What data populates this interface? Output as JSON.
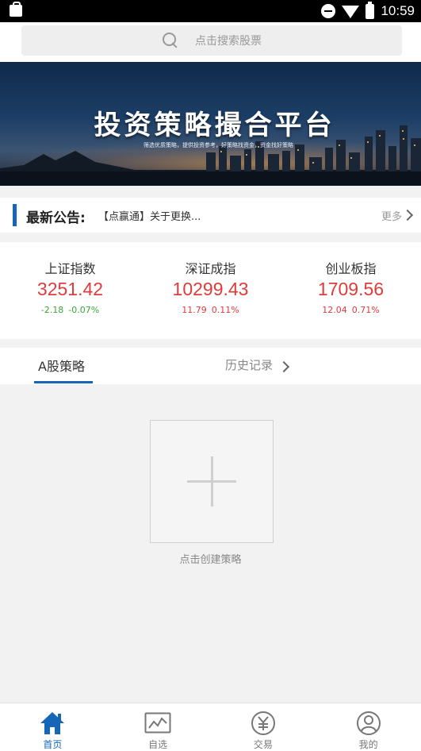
{
  "status_bar": {
    "time": "10:59"
  },
  "search": {
    "placeholder": "点击搜索股票"
  },
  "banner": {
    "title": "投资策略撮合平台",
    "subtitle": "筛选优质策略，提供投资参考，好策略找资金，资金找好策略"
  },
  "notice": {
    "title": "最新公告:",
    "text": "【点赢通】关于更换...",
    "more": "更多"
  },
  "indices": [
    {
      "name": "上证指数",
      "value": "3251.42",
      "change": "-2.18",
      "pct": "-0.07%",
      "trend": "down"
    },
    {
      "name": "深证成指",
      "value": "10299.43",
      "change": "11.79",
      "pct": "0.11%",
      "trend": "up"
    },
    {
      "name": "创业板指",
      "value": "1709.56",
      "change": "12.04",
      "pct": "0.71%",
      "trend": "up"
    }
  ],
  "tabs": {
    "active": "A股策略",
    "history": "历史记录"
  },
  "create": {
    "label": "点击创建策略"
  },
  "bottom_nav": [
    {
      "label": "首页",
      "icon": "home-icon",
      "active": true
    },
    {
      "label": "自选",
      "icon": "chart-icon",
      "active": false
    },
    {
      "label": "交易",
      "icon": "yen-icon",
      "active": false
    },
    {
      "label": "我的",
      "icon": "user-icon",
      "active": false
    }
  ],
  "colors": {
    "accent": "#1566b6",
    "up": "#e03b3b",
    "down": "#3aa53a"
  }
}
